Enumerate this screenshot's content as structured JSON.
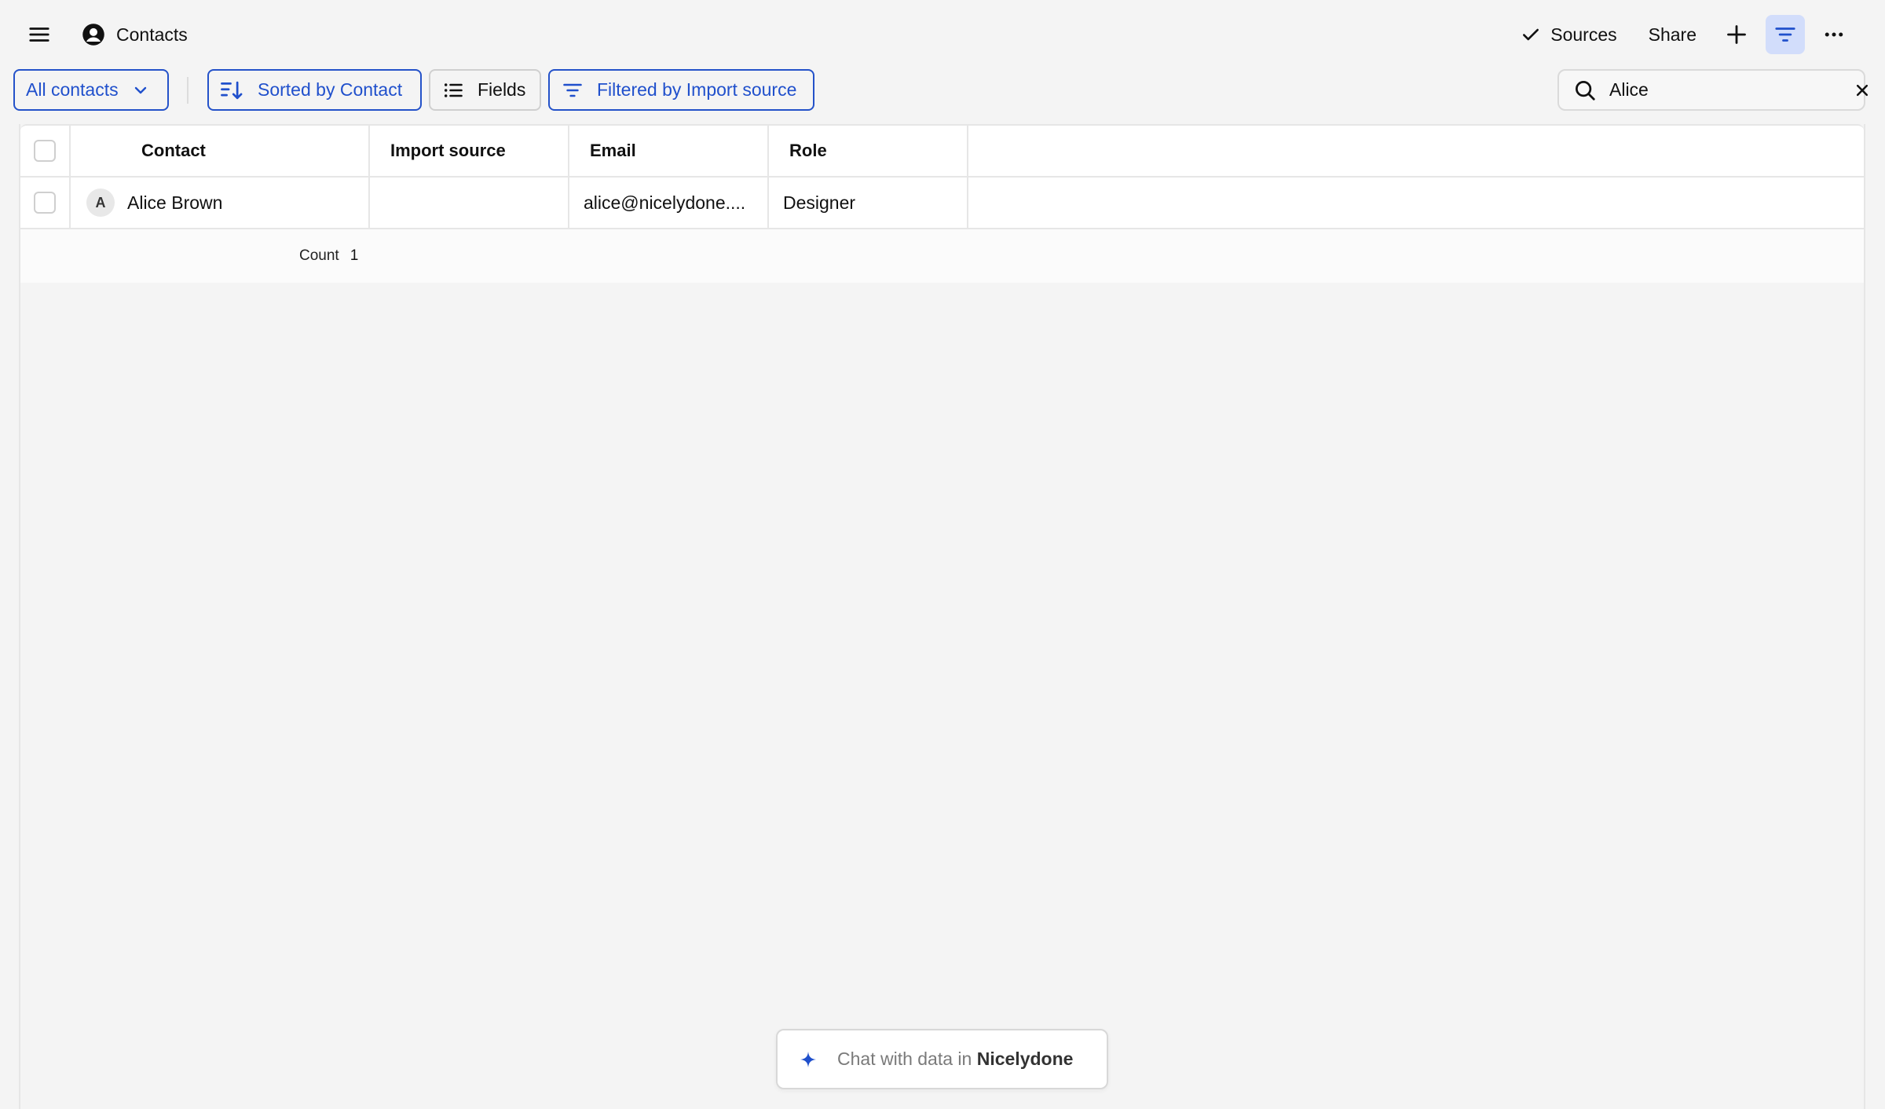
{
  "header": {
    "title": "Contacts",
    "sources_label": "Sources",
    "share_label": "Share"
  },
  "toolbar": {
    "view_label": "All contacts",
    "sort_label": "Sorted by Contact",
    "fields_label": "Fields",
    "filter_label": "Filtered by Import source"
  },
  "search": {
    "value": "Alice"
  },
  "table": {
    "columns": [
      "Contact",
      "Import source",
      "Email",
      "Role"
    ],
    "rows": [
      {
        "avatar_initial": "A",
        "contact": "Alice Brown",
        "import_source": "",
        "email": "alice@nicelydone....",
        "role": "Designer"
      }
    ],
    "footer": {
      "count_label": "Count",
      "count_value": "1"
    }
  },
  "chat": {
    "prefix": "Chat with data in",
    "brand": "Nicelydone"
  },
  "colors": {
    "accent": "#2050cc",
    "accent_bg": "#d2ddfb",
    "background": "#f4f4f4"
  }
}
